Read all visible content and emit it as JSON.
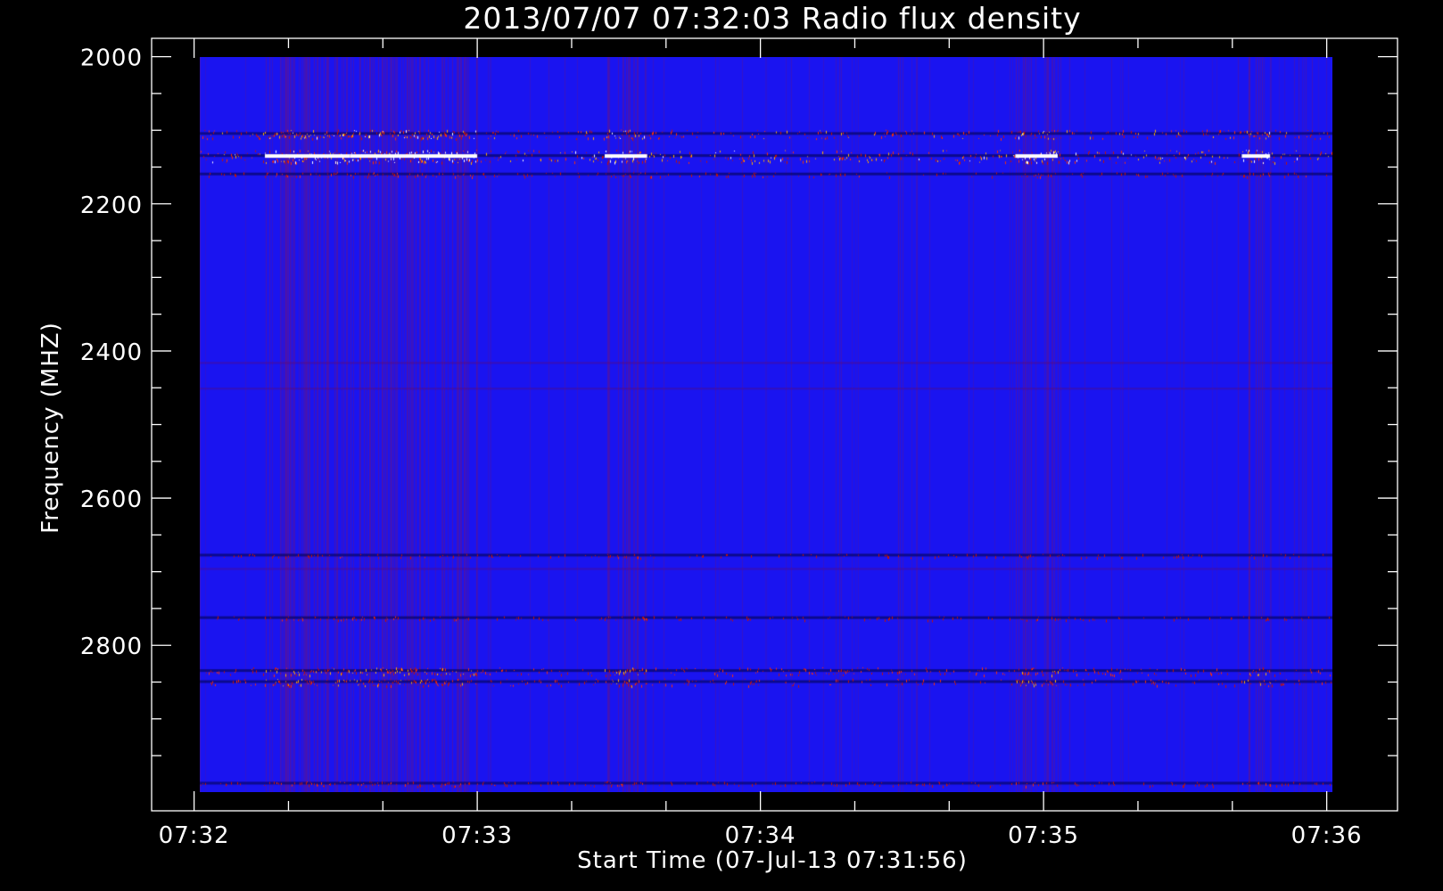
{
  "chart_data": {
    "type": "heatmap",
    "title": "2013/07/07 07:32:03 Radio flux density",
    "xlabel": "Start Time (07-Jul-13 07:31:56)",
    "ylabel": "Frequency (MHZ)",
    "x_tick_labels": [
      "07:32",
      "07:33",
      "07:34",
      "07:35",
      "07:36"
    ],
    "x_tick_values_min": [
      0,
      1,
      2,
      3,
      4
    ],
    "x_data_range_min": [
      0.02,
      4.02
    ],
    "xlim_min": [
      -0.15,
      4.25
    ],
    "y_tick_labels": [
      "2000",
      "2200",
      "2400",
      "2600",
      "2800"
    ],
    "y_tick_values": [
      2000,
      2200,
      2400,
      2600,
      2800
    ],
    "ylim": [
      1975,
      3025
    ],
    "y_data_range": [
      2000,
      3000
    ],
    "y_reversed": true,
    "colormap": {
      "background": "#1a14f0",
      "low": "#000050",
      "mid": "#c81400",
      "high": "#ffffff"
    },
    "bright_bands_mhz": [
      {
        "freq": 2105,
        "intensity": 0.7
      },
      {
        "freq": 2135,
        "intensity": 1.0
      },
      {
        "freq": 2160,
        "intensity": 0.35
      },
      {
        "freq": 2678,
        "intensity": 0.25
      },
      {
        "freq": 2763,
        "intensity": 0.3
      },
      {
        "freq": 2835,
        "intensity": 0.6
      },
      {
        "freq": 2850,
        "intensity": 0.55
      },
      {
        "freq": 2988,
        "intensity": 0.35
      }
    ],
    "active_time_ranges_min": [
      [
        0.25,
        0.55
      ],
      [
        0.55,
        1.0
      ],
      [
        1.45,
        1.6
      ],
      [
        2.9,
        3.05
      ],
      [
        3.7,
        3.8
      ]
    ]
  }
}
